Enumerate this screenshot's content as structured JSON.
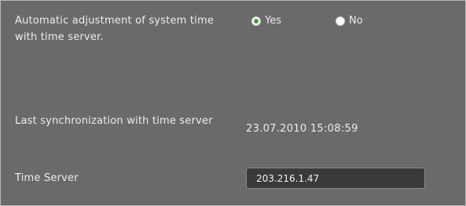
{
  "auto_adjust": {
    "label": "Automatic adjustment of system time with time server.",
    "options": [
      {
        "label": "Yes",
        "selected": true
      },
      {
        "label": "No",
        "selected": false
      }
    ]
  },
  "last_sync": {
    "label": "Last synchronization with time server",
    "value": "23.07.2010 15:08:59"
  },
  "time_server": {
    "label": "Time Server",
    "value": "203.216.1.47"
  },
  "colors": {
    "panel_bg": "#6a6a6a",
    "text": "#ececec",
    "radio_selected": "#3f9b2f",
    "input_bg": "#3a3a3a"
  }
}
